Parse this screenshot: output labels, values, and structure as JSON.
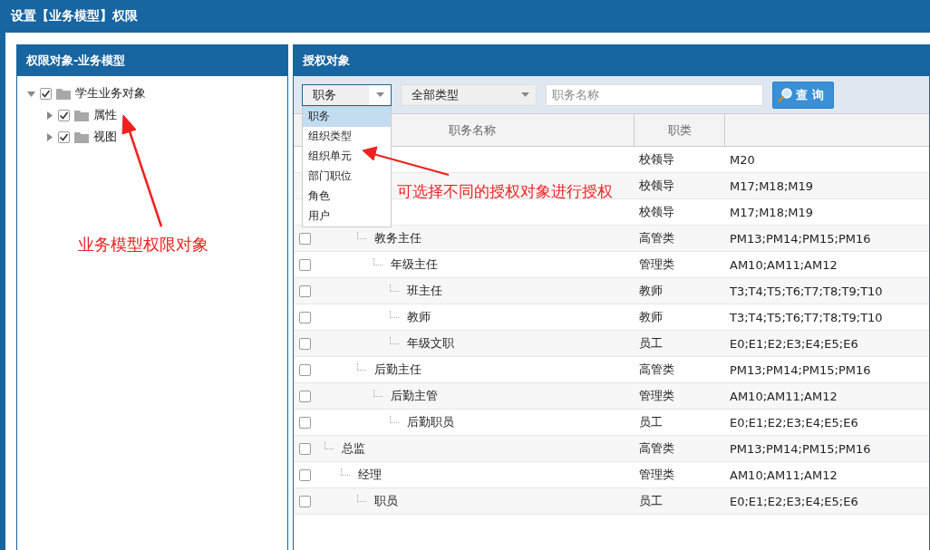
{
  "window": {
    "title": "设置【业务模型】权限"
  },
  "left_panel": {
    "title": "权限对象-业务模型",
    "tree": [
      {
        "label": "学生业务对象",
        "checked": true,
        "expanded": true,
        "children": [
          {
            "label": "属性",
            "checked": true,
            "expanded": false
          },
          {
            "label": "视图",
            "checked": true,
            "expanded": false
          }
        ]
      }
    ]
  },
  "right_panel": {
    "title": "授权对象",
    "toolbar": {
      "object_select": {
        "value": "职务",
        "open": true,
        "options": [
          {
            "label": "职务",
            "selected": true
          },
          {
            "label": "组织类型",
            "selected": false
          },
          {
            "label": "组织单元",
            "selected": false
          },
          {
            "label": "部门职位",
            "selected": false
          },
          {
            "label": "角色",
            "selected": false
          },
          {
            "label": "用户",
            "selected": false
          }
        ]
      },
      "type_select": {
        "value": "全部类型"
      },
      "name_field": {
        "placeholder": "职务名称"
      },
      "search_button": "查 询"
    },
    "table": {
      "columns": [
        "职务名称",
        "职类"
      ],
      "rows": [
        {
          "category": "校领导",
          "grades": "M20",
          "children": [
            {
              "category": "校领导",
              "grades": "M17;M18;M19"
            },
            {
              "category": "校领导",
              "grades": "M17;M18;M19",
              "children": [
                {
                  "name": "教务主任",
                  "checked": false,
                  "category": "高管类",
                  "grades": "PM13;PM14;PM15;PM16",
                  "children": [
                    {
                      "name": "年级主任",
                      "checked": false,
                      "category": "管理类",
                      "grades": "AM10;AM11;AM12",
                      "children": [
                        {
                          "name": "班主任",
                          "checked": false,
                          "category": "教师",
                          "grades": "T3;T4;T5;T6;T7;T8;T9;T10"
                        },
                        {
                          "name": "教师",
                          "checked": false,
                          "category": "教师",
                          "grades": "T3;T4;T5;T6;T7;T8;T9;T10"
                        },
                        {
                          "name": "年级文职",
                          "checked": false,
                          "category": "员工",
                          "grades": "E0;E1;E2;E3;E4;E5;E6"
                        }
                      ]
                    }
                  ]
                },
                {
                  "name": "后勤主任",
                  "checked": false,
                  "category": "高管类",
                  "grades": "PM13;PM14;PM15;PM16",
                  "children": [
                    {
                      "name": "后勤主管",
                      "checked": false,
                      "category": "管理类",
                      "grades": "AM10;AM11;AM12",
                      "children": [
                        {
                          "name": "后勤职员",
                          "checked": false,
                          "category": "员工",
                          "grades": "E0;E1;E2;E3;E4;E5;E6"
                        }
                      ]
                    }
                  ]
                }
              ]
            }
          ]
        },
        {
          "name": "总监",
          "checked": false,
          "category": "高管类",
          "grades": "PM13;PM14;PM15;PM16",
          "children": [
            {
              "name": "经理",
              "checked": false,
              "category": "管理类",
              "grades": "AM10;AM11;AM12",
              "children": [
                {
                  "name": "职员",
                  "checked": false,
                  "category": "员工",
                  "grades": "E0;E1;E2;E3;E4;E5;E6"
                }
              ]
            }
          ]
        }
      ]
    }
  },
  "annotations": [
    {
      "text": "业务模型权限对象"
    },
    {
      "text": "可选择不同的授权对象进行授权"
    }
  ]
}
